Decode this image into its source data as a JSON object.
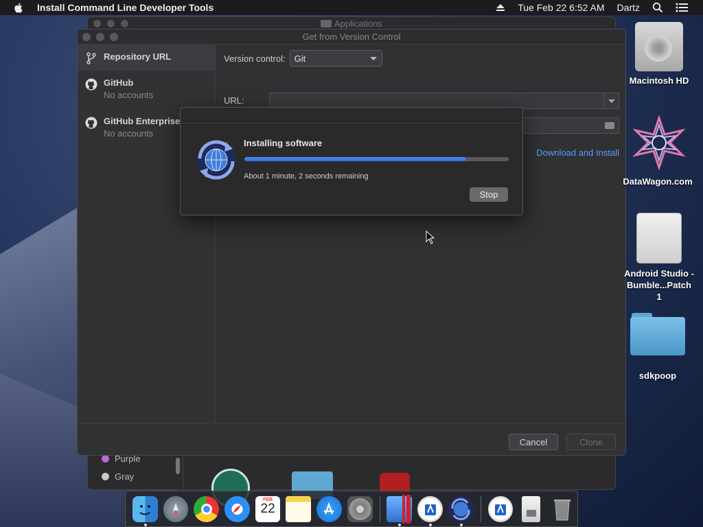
{
  "menubar": {
    "app_name": "Install Command Line Developer Tools",
    "date_time": "Tue Feb 22  6:52 AM",
    "user": "Dartz"
  },
  "finder_window": {
    "title": "Applications",
    "tags": [
      {
        "label": "Purple",
        "color": "#b76bd3"
      },
      {
        "label": "Gray",
        "color": "#c8c8c8"
      }
    ]
  },
  "vcs_window": {
    "title": "Get from Version Control",
    "sidebar": [
      {
        "label": "Repository URL",
        "sub": "",
        "icon": "branch-icon",
        "selected": true
      },
      {
        "label": "GitHub",
        "sub": "No accounts",
        "icon": "github-icon",
        "selected": false
      },
      {
        "label": "GitHub Enterprise",
        "sub": "No accounts",
        "icon": "github-icon",
        "selected": false
      }
    ],
    "version_control_label": "Version control:",
    "version_control_value": "Git",
    "url_label": "URL:",
    "url_value": "",
    "directory_label": "",
    "download_link": "Download and Install",
    "cancel_label": "Cancel",
    "clone_label": "Clone"
  },
  "install_dialog": {
    "title": "Installing software",
    "eta": "About 1 minute, 2 seconds remaining",
    "progress_fraction": 0.84,
    "stop_label": "Stop"
  },
  "desktop_icons": [
    {
      "label": "Macintosh HD",
      "icon": "hard-drive-icon"
    },
    {
      "label": "DataWagon.com",
      "icon": "datawagon-icon"
    },
    {
      "label": "Android Studio - Bumble...Patch 1",
      "icon": "disk-image-icon"
    },
    {
      "label": "sdkpoop",
      "icon": "folder-icon"
    }
  ],
  "dock": {
    "apps": [
      "finder-icon",
      "launchpad-icon",
      "chrome-icon",
      "safari-icon",
      "calendar-icon",
      "notes-icon",
      "app-store-icon",
      "system-preferences-icon",
      "android-studio-icon",
      "ios-app-icon",
      "software-update-icon",
      "xcode-icon",
      "file-icon",
      "trash-icon"
    ],
    "calendar_month": "FEB",
    "calendar_day": "22"
  },
  "colors": {
    "accent_blue": "#2e6be0",
    "link_blue": "#589df6"
  }
}
